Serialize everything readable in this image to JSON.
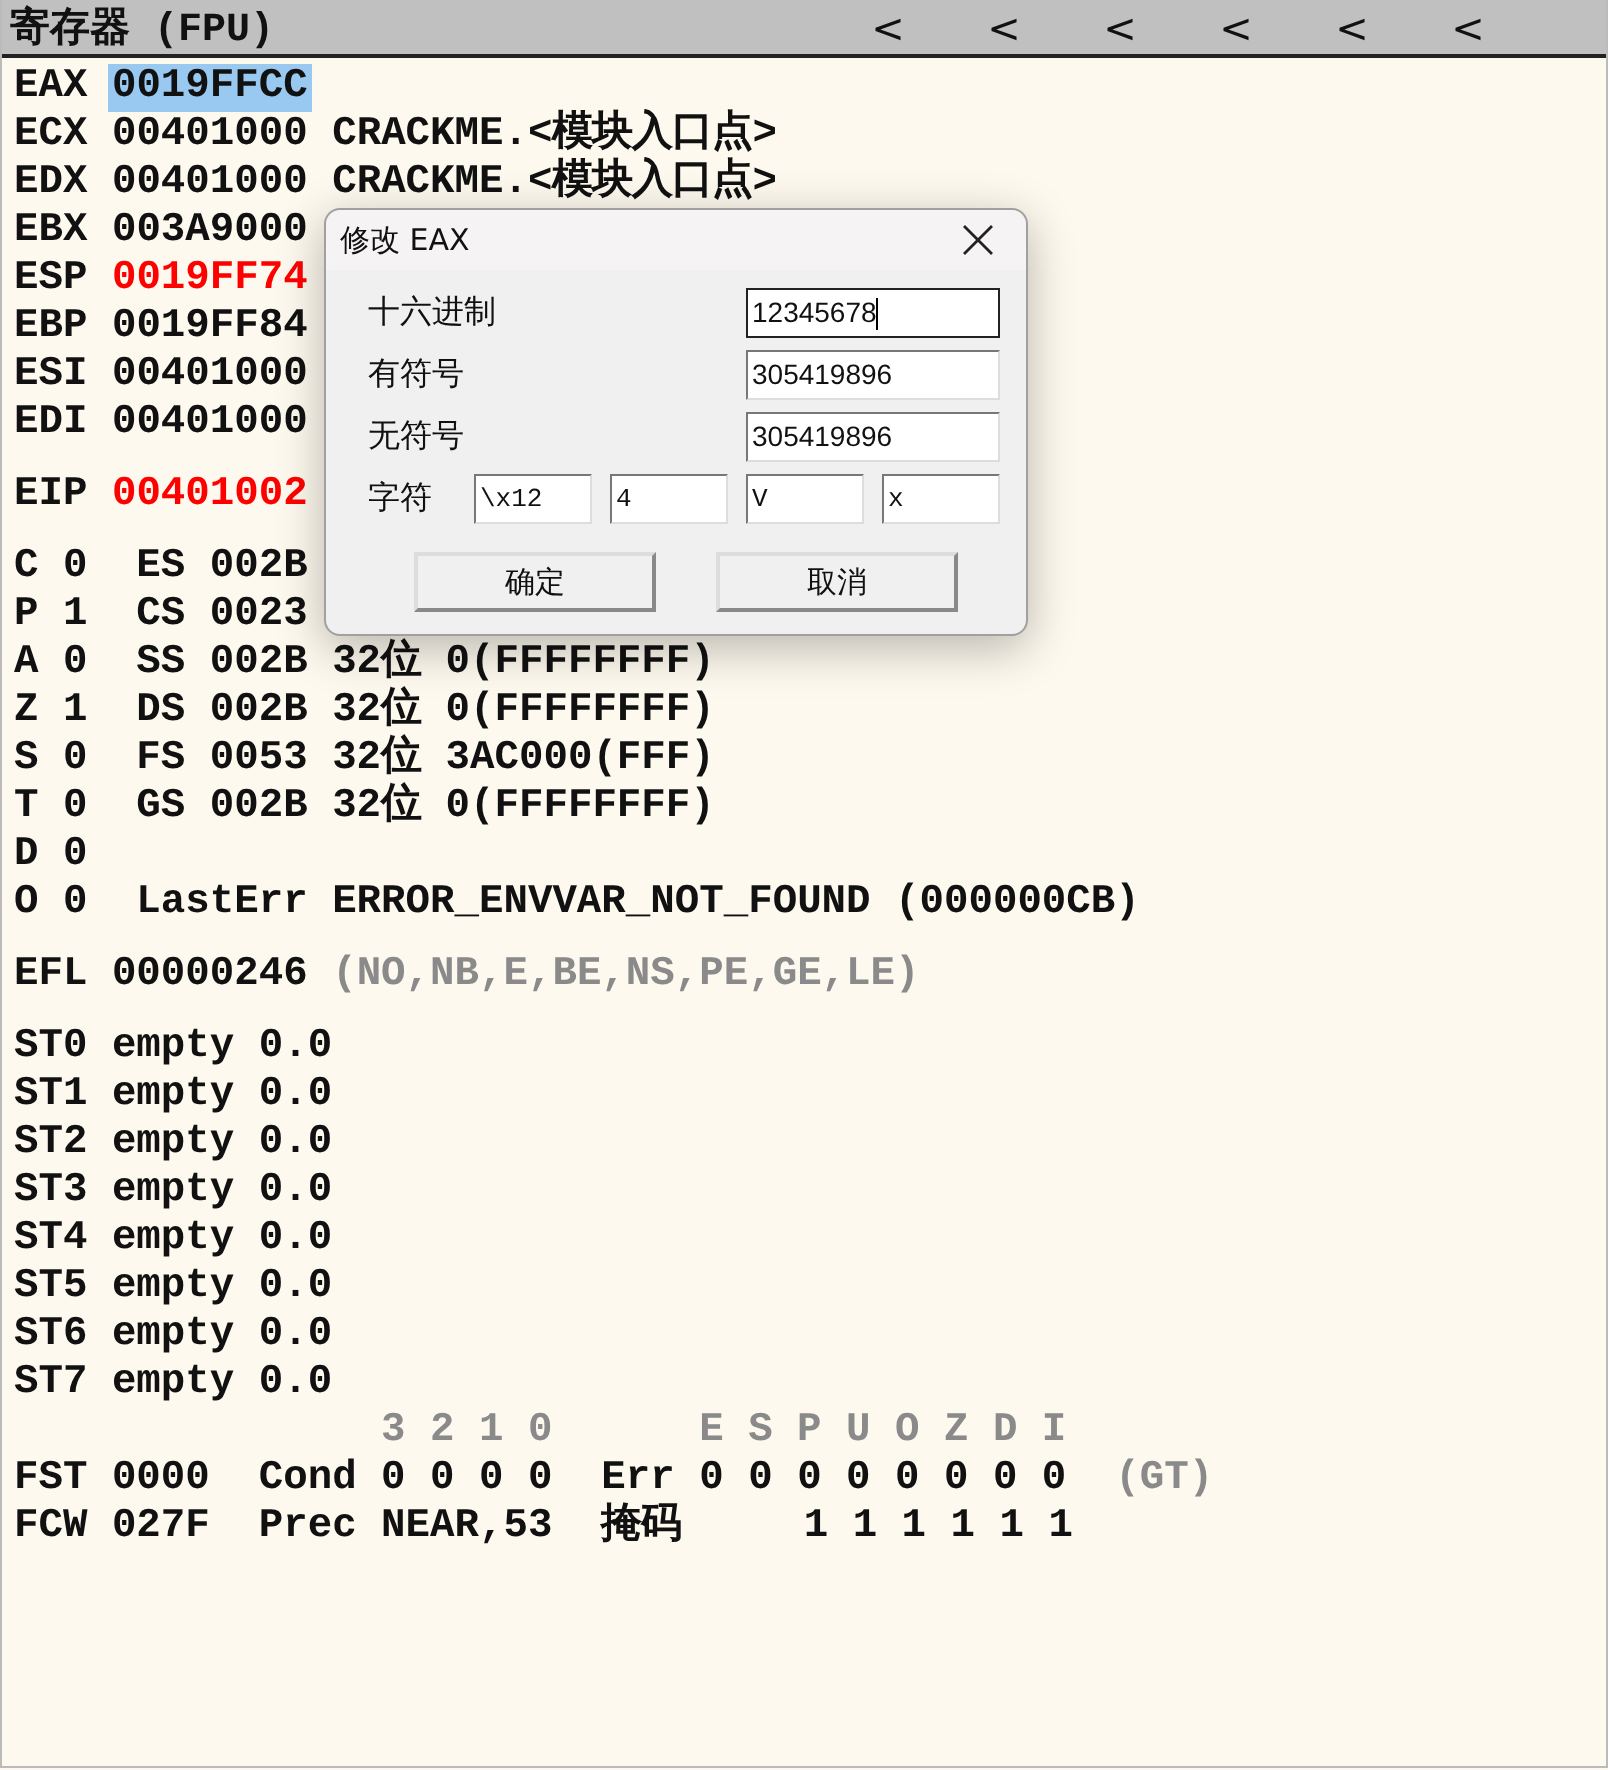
{
  "header": {
    "title": "寄存器 (FPU)",
    "arrows": [
      "<",
      "<",
      "<",
      "<",
      "<",
      "<"
    ]
  },
  "groups": [
    {
      "rows": [
        {
          "segments": [
            {
              "text": "EAX",
              "color": "#111111",
              "selected": false
            },
            {
              "text": "0019FFCC",
              "selected": true
            }
          ]
        },
        {
          "segments": [
            {
              "text": "ECX",
              "color": "#111111",
              "selected": false
            },
            {
              "text": "00401000",
              "color": "#111111",
              "selected": false
            },
            {
              "text": "CRACKME.<模块入口点>",
              "color": "#111111",
              "selected": false
            }
          ]
        },
        {
          "segments": [
            {
              "text": "EDX",
              "color": "#111111",
              "selected": false
            },
            {
              "text": "00401000",
              "color": "#111111",
              "selected": false
            },
            {
              "text": "CRACKME.<模块入口点>",
              "color": "#111111",
              "selected": false
            }
          ]
        },
        {
          "segments": [
            {
              "text": "EBX",
              "color": "#111111",
              "selected": false
            },
            {
              "text": "003A9000",
              "color": "#111111",
              "selected": false
            }
          ]
        },
        {
          "segments": [
            {
              "text": "ESP",
              "color": "#111111",
              "selected": false
            },
            {
              "text": "0019FF74",
              "color": "#ff0000",
              "selected": false
            }
          ]
        },
        {
          "segments": [
            {
              "text": "EBP",
              "color": "#111111",
              "selected": false
            },
            {
              "text": "0019FF84",
              "color": "#111111",
              "selected": false
            }
          ]
        },
        {
          "segments": [
            {
              "text": "ESI",
              "color": "#111111",
              "selected": false
            },
            {
              "text": "00401000",
              "color": "#111111",
              "selected": false
            }
          ]
        },
        {
          "segments": [
            {
              "text": "EDI",
              "color": "#111111",
              "selected": false
            },
            {
              "text": "00401000",
              "color": "#111111",
              "selected": false
            }
          ]
        }
      ]
    },
    {
      "rows": [
        {
          "segments": [
            {
              "text": "EIP",
              "color": "#111111",
              "selected": false
            },
            {
              "text": "00401002",
              "color": "#ff0000",
              "selected": false
            }
          ]
        }
      ]
    },
    {
      "rows": [
        {
          "segments": [
            {
              "text": "C 0  ES 002B",
              "color": "#111111",
              "selected": false
            }
          ]
        },
        {
          "segments": [
            {
              "text": "P 1  CS 0023",
              "color": "#111111",
              "selected": false
            }
          ]
        },
        {
          "segments": [
            {
              "text": "A 0  SS 002B 32位 0(FFFFFFFF)",
              "color": "#111111",
              "selected": false
            }
          ]
        },
        {
          "segments": [
            {
              "text": "Z 1  DS 002B 32位 0(FFFFFFFF)",
              "color": "#111111",
              "selected": false
            }
          ]
        },
        {
          "segments": [
            {
              "text": "S 0  FS 0053 32位 3AC000(FFF)",
              "color": "#111111",
              "selected": false
            }
          ]
        },
        {
          "segments": [
            {
              "text": "T 0  GS 002B 32位 0(FFFFFFFF)",
              "color": "#111111",
              "selected": false
            }
          ]
        },
        {
          "segments": [
            {
              "text": "D 0",
              "color": "#111111",
              "selected": false
            }
          ]
        },
        {
          "segments": [
            {
              "text": "O 0  LastErr ERROR_ENVVAR_NOT_FOUND (000000CB)",
              "color": "#111111",
              "selected": false
            }
          ]
        }
      ]
    },
    {
      "rows": [
        {
          "segments": [
            {
              "text": "EFL 00000246",
              "color": "#111111",
              "selected": false
            },
            {
              "text": "(NO,NB,E,BE,NS,PE,GE,LE)",
              "color": "#8a8a8a",
              "selected": false
            }
          ]
        }
      ]
    },
    {
      "rows": [
        {
          "segments": [
            {
              "text": "ST0 empty 0.0",
              "color": "#111111",
              "selected": false
            }
          ]
        },
        {
          "segments": [
            {
              "text": "ST1 empty 0.0",
              "color": "#111111",
              "selected": false
            }
          ]
        },
        {
          "segments": [
            {
              "text": "ST2 empty 0.0",
              "color": "#111111",
              "selected": false
            }
          ]
        },
        {
          "segments": [
            {
              "text": "ST3 empty 0.0",
              "color": "#111111",
              "selected": false
            }
          ]
        },
        {
          "segments": [
            {
              "text": "ST4 empty 0.0",
              "color": "#111111",
              "selected": false
            }
          ]
        },
        {
          "segments": [
            {
              "text": "ST5 empty 0.0",
              "color": "#111111",
              "selected": false
            }
          ]
        },
        {
          "segments": [
            {
              "text": "ST6 empty 0.0",
              "color": "#111111",
              "selected": false
            }
          ]
        },
        {
          "segments": [
            {
              "text": "ST7 empty 0.0",
              "color": "#111111",
              "selected": false
            }
          ]
        },
        {
          "kind": "bits",
          "segments": [
            {
              "text": "3 2 1 0      E S P U O Z D I",
              "color": "#8a8a8a",
              "selected": false
            }
          ]
        },
        {
          "segments": [
            {
              "text": "FST 0000  Cond 0 0 0 0  Err 0 0 0 0 0 0 0 0",
              "color": "#111111",
              "selected": false
            },
            {
              "text": " (GT)",
              "color": "#8a8a8a",
              "selected": false
            }
          ]
        },
        {
          "segments": [
            {
              "text": "FCW 027F  Prec NEAR,53  掩码     1 1 1 1 1 1",
              "color": "#111111",
              "selected": false
            }
          ]
        }
      ]
    }
  ],
  "dialog": {
    "title": "修改 EAX",
    "fields": [
      {
        "label": "十六进制",
        "value": "12345678",
        "focused": true
      },
      {
        "label": "有符号",
        "value": "305419896",
        "focused": false
      },
      {
        "label": "无符号",
        "value": "305419896",
        "focused": false
      }
    ],
    "char_label": "字符",
    "char_fields": [
      "\\x12",
      "4",
      "V",
      "x"
    ],
    "buttons": [
      "确定",
      "取消"
    ]
  }
}
